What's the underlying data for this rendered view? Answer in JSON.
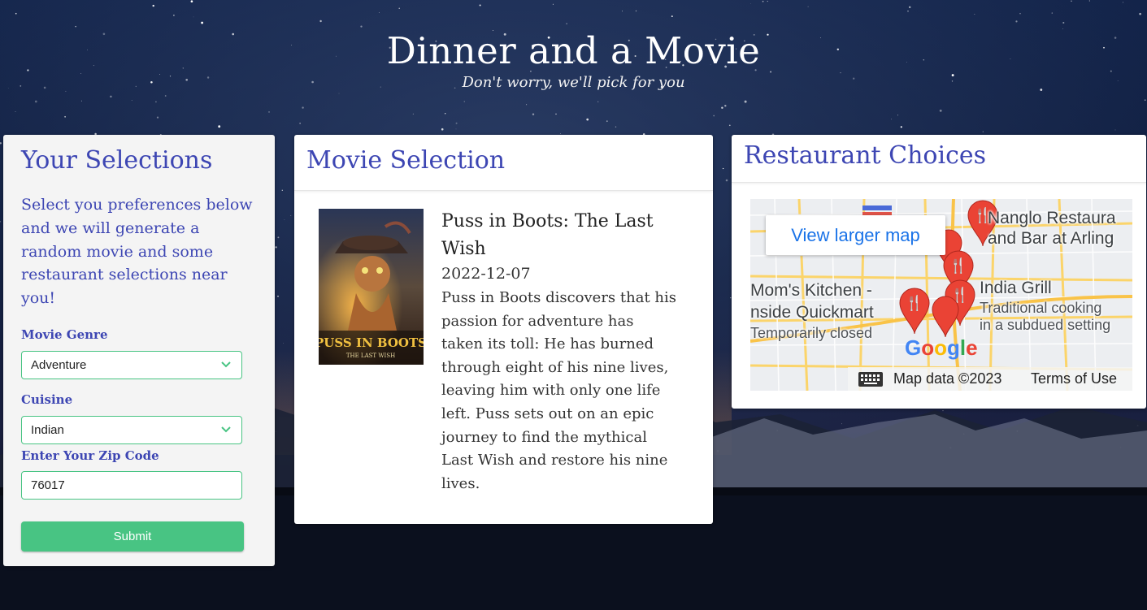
{
  "header": {
    "title": "Dinner and a Movie",
    "subtitle": "Don't worry, we'll pick for you"
  },
  "selections": {
    "title": "Your Selections",
    "description": "Select you preferences below and we will generate a random movie and some restaurant selections near you!",
    "genre_label": "Movie Genre",
    "genre_value": "Adventure",
    "cuisine_label": "Cuisine",
    "cuisine_value": "Indian",
    "zip_label": "Enter Your Zip Code",
    "zip_value": "76017",
    "submit_label": "Submit"
  },
  "movie": {
    "section_title": "Movie Selection",
    "title": "Puss in Boots: The Last Wish",
    "release_date": "2022-12-07",
    "overview": "Puss in Boots discovers that his passion for adventure has taken its toll: He has burned through eight of his nine lives, leaving him with only one life left. Puss sets out on an epic journey to find the mythical Last Wish and restore his nine lives.",
    "poster": {
      "line1": "PUSS IN BOOTS",
      "line2": "THE LAST WISH"
    }
  },
  "restaurants": {
    "section_title": "Restaurant Choices",
    "map": {
      "view_larger_label": "View larger map",
      "places": [
        {
          "name_line1": "Nanglo Restaura",
          "name_line2": "and Bar at Arling"
        },
        {
          "name_line1": "Mom's Kitchen -",
          "name_line2": "nside Quickmart",
          "status": "Temporarily closed"
        },
        {
          "name_line1": "India Grill",
          "desc_line1": "Traditional cooking",
          "desc_line2": "in a subdued setting"
        }
      ],
      "logo": "Google",
      "attribution": "Map data ©2023",
      "terms_label": "Terms of Use"
    }
  },
  "colors": {
    "accent": "#3d46b3",
    "button_green": "#48c483",
    "map_pin": "#ea4335"
  }
}
